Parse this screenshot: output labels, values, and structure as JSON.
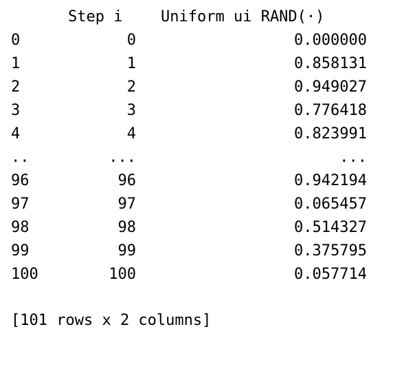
{
  "table": {
    "headers": {
      "step": "Step i",
      "uniform": "Uniform ui RAND(·)"
    },
    "rows": [
      {
        "index": "0",
        "step": "0",
        "value": "0.000000"
      },
      {
        "index": "1",
        "step": "1",
        "value": "0.858131"
      },
      {
        "index": "2",
        "step": "2",
        "value": "0.949027"
      },
      {
        "index": "3",
        "step": "3",
        "value": "0.776418"
      },
      {
        "index": "4",
        "step": "4",
        "value": "0.823991"
      },
      {
        "index": "..",
        "step": "...",
        "value": "..."
      },
      {
        "index": "96",
        "step": "96",
        "value": "0.942194"
      },
      {
        "index": "97",
        "step": "97",
        "value": "0.065457"
      },
      {
        "index": "98",
        "step": "98",
        "value": "0.514327"
      },
      {
        "index": "99",
        "step": "99",
        "value": "0.375795"
      },
      {
        "index": "100",
        "step": "100",
        "value": "0.057714"
      }
    ],
    "summary": "[101 rows x 2 columns]"
  }
}
